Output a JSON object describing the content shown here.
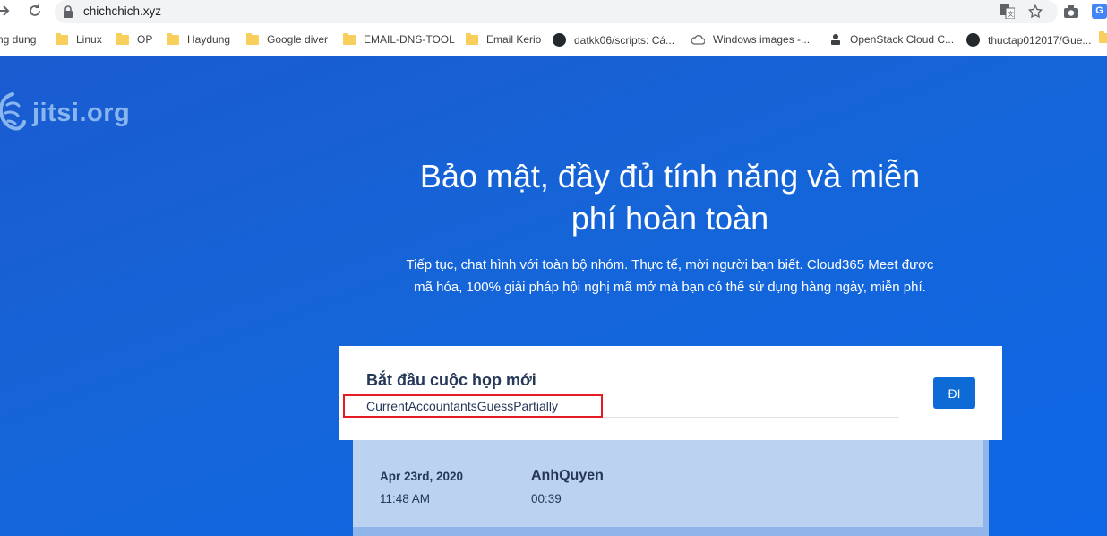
{
  "browser": {
    "url": "chichchich.xyz",
    "extension_label": "G"
  },
  "bookmarks": [
    {
      "label": "ng dụng",
      "icon": "none"
    },
    {
      "label": "Linux",
      "icon": "folder-icon"
    },
    {
      "label": "OP",
      "icon": "folder-icon"
    },
    {
      "label": "Haydung",
      "icon": "folder-icon"
    },
    {
      "label": "Google diver",
      "icon": "folder-icon"
    },
    {
      "label": "EMAIL-DNS-TOOL",
      "icon": "folder-icon"
    },
    {
      "label": "Email Kerio",
      "icon": "folder-icon"
    },
    {
      "label": "datkk06/scripts: Cá...",
      "icon": "github-icon"
    },
    {
      "label": "Windows images -...",
      "icon": "cloud-icon"
    },
    {
      "label": "OpenStack Cloud C...",
      "icon": "openstack-icon"
    },
    {
      "label": "thuctap012017/Gue...",
      "icon": "github-icon"
    }
  ],
  "page": {
    "logo_text": "jitsi.org",
    "title_line1": "Bảo mật, đầy đủ tính năng và miễn",
    "title_line2": "phí hoàn toàn",
    "subtitle_line1": "Tiếp tục, chat hình với toàn bộ nhóm. Thực tế, mời người bạn biết. Cloud365 Meet được",
    "subtitle_line2": "mã hóa, 100% giải pháp hội nghị mã mở mà bạn có thể sử dụng hàng ngày, miễn phí.",
    "start_label": "Bắt đầu cuộc họp mới",
    "room_input_value": "CurrentAccountantsGuessPartially",
    "go_button": "ĐI"
  },
  "recent_meetings": [
    {
      "date": "Apr 23rd, 2020",
      "time": "11:48 AM",
      "name": "AnhQuyen",
      "duration": "00:39"
    }
  ],
  "colors": {
    "hero_blue": "#1565d8",
    "button_blue": "#0e6bd6",
    "highlight_red": "#e51c23",
    "recent_bg": "#bcd2f1"
  }
}
